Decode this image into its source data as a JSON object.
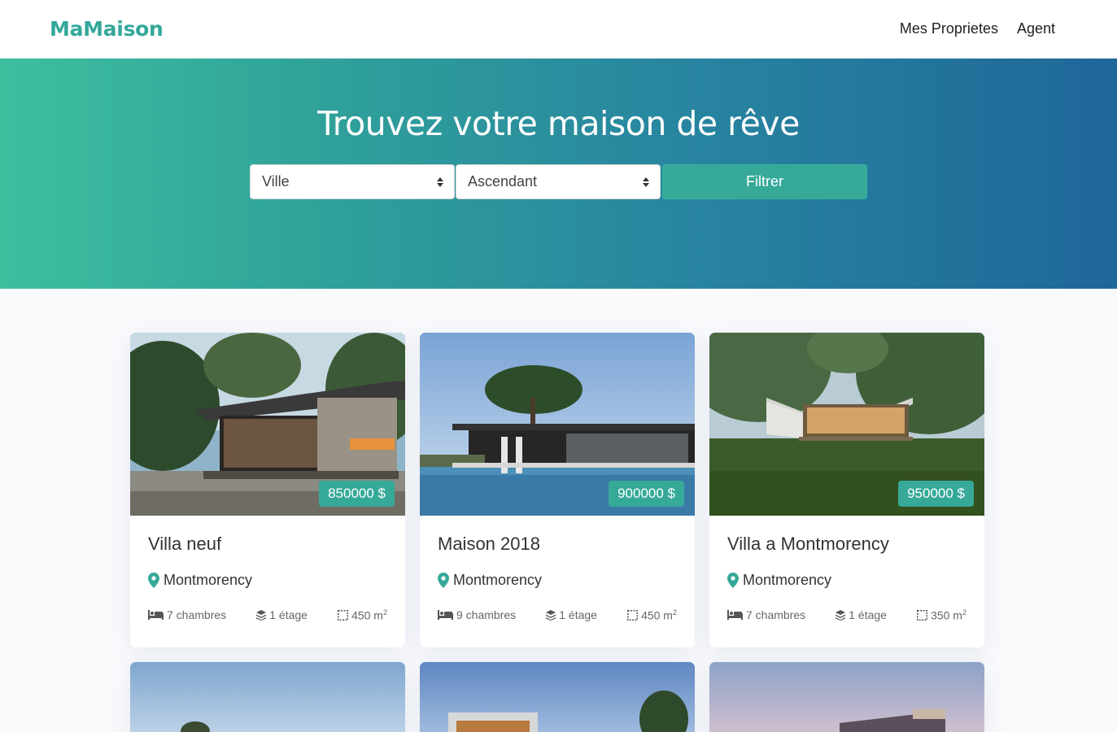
{
  "navbar": {
    "brand": "MaMaison",
    "links": [
      "Mes Proprietes",
      "Agent"
    ]
  },
  "hero": {
    "title": "Trouvez votre maison de rêve",
    "city_select": "Ville",
    "order_select": "Ascendant",
    "filter_button": "Filtrer"
  },
  "colors": {
    "accent": "#36a999",
    "gradient_start": "#3dbf9e",
    "gradient_end": "#1e6799"
  },
  "properties": [
    {
      "title": "Villa neuf",
      "price": "850000 $",
      "location": "Montmorency",
      "rooms": "7 chambres",
      "floors": "1 étage",
      "area": "450 m",
      "area_unit_exp": "2"
    },
    {
      "title": "Maison 2018",
      "price": "900000 $",
      "location": "Montmorency",
      "rooms": "9 chambres",
      "floors": "1 étage",
      "area": "450 m",
      "area_unit_exp": "2"
    },
    {
      "title": "Villa a Montmorency",
      "price": "950000 $",
      "location": "Montmorency",
      "rooms": "7 chambres",
      "floors": "1 étage",
      "area": "350 m",
      "area_unit_exp": "2"
    }
  ],
  "icons": {
    "location": "map-pin-icon",
    "rooms": "bed-icon",
    "floors": "layers-icon",
    "area": "area-icon"
  }
}
